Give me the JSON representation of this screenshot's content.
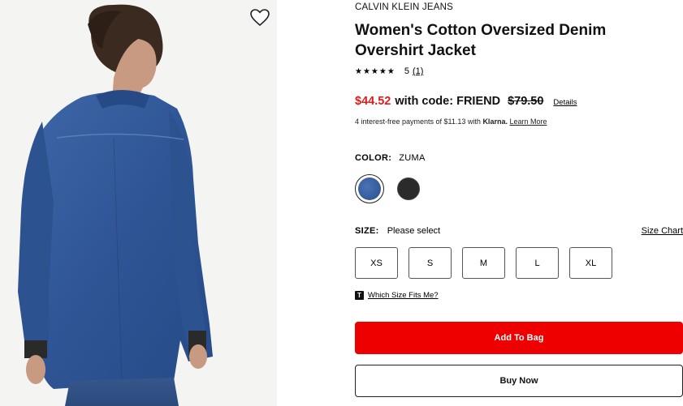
{
  "product": {
    "brand": "CALVIN KLEIN JEANS",
    "title": "Women's Cotton Oversized Denim Overshirt Jacket",
    "image_alt": "product-photo"
  },
  "rating": {
    "stars": "★★★★★",
    "score": "5",
    "count": "(1)"
  },
  "price": {
    "sale": "$44.52",
    "promo": "with code: FRIEND",
    "original": "$79.50",
    "details_label": "Details"
  },
  "klarna": {
    "text": "4 interest-free payments of $11.13 with",
    "brand": "Klarna.",
    "link": "Learn More"
  },
  "color": {
    "label": "COLOR:",
    "value": "ZUMA",
    "swatches": [
      {
        "name": "Zuma",
        "color": "#2f4f8f",
        "selected": true
      },
      {
        "name": "Black",
        "color": "#2b2b2b",
        "selected": false
      }
    ]
  },
  "size": {
    "label": "SIZE:",
    "value": "Please select",
    "chart_label": "Size Chart",
    "options": [
      "XS",
      "S",
      "M",
      "L",
      "XL"
    ]
  },
  "fit": {
    "icon": "T",
    "label": "Which Size Fits Me?"
  },
  "actions": {
    "add_to_bag": "Add To Bag",
    "buy_now": "Buy Now"
  },
  "colors": {
    "sale": "#e11a1a",
    "add_button": "#ee0000"
  },
  "icons": {
    "favorite": "heart-outline-icon"
  }
}
